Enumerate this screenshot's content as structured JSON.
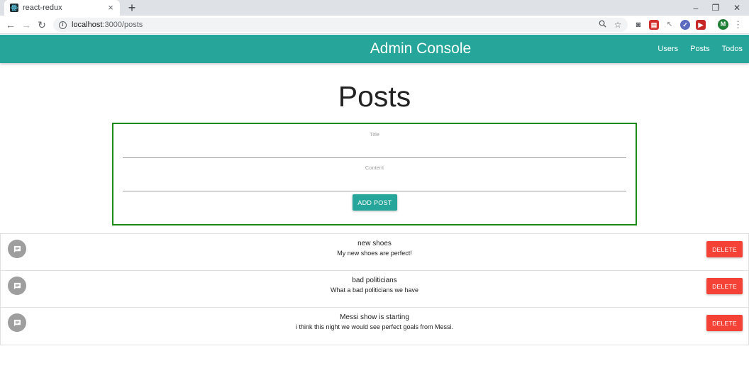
{
  "browser": {
    "tab_title": "react-redux",
    "tab_close": "×",
    "new_tab": "+",
    "window_controls": {
      "minimize": "–",
      "restore": "❐",
      "close": "✕"
    },
    "nav": {
      "back": "←",
      "forward": "→",
      "reload": "↻"
    },
    "url_host": "localhost",
    "url_path": ":3000/posts",
    "icons": [
      "info-icon",
      "zoom-icon",
      "bookmark-star-icon",
      "camera-icon",
      "extension-icons",
      "profile-avatar",
      "menu-icon"
    ],
    "profile_initial": "M",
    "menu_dots": "⋮",
    "colors": {
      "tabstrip": "#dee1e6",
      "omnibox": "#f1f3f4"
    }
  },
  "app": {
    "brand": "Admin Console",
    "nav_links": [
      "Users",
      "Posts",
      "Todos"
    ],
    "page_title": "Posts",
    "form": {
      "title_label": "Title",
      "title_value": "",
      "content_label": "Content",
      "content_value": "",
      "submit_label": "ADD POST"
    },
    "posts": [
      {
        "title": "new shoes",
        "content": "My new shoes are perfect!",
        "delete_label": "DELETE"
      },
      {
        "title": "bad politicians",
        "content": "What a bad politicians we have",
        "delete_label": "DELETE"
      },
      {
        "title": "Messi show is starting",
        "content": "i think this night we would see perfect goals from Messi.",
        "delete_label": "DELETE"
      }
    ],
    "colors": {
      "navbar": "#26a69a",
      "form_border": "#1b8a1b",
      "add_button": "#26a69a",
      "delete_button": "#f44336",
      "avatar": "#9e9e9e"
    }
  }
}
